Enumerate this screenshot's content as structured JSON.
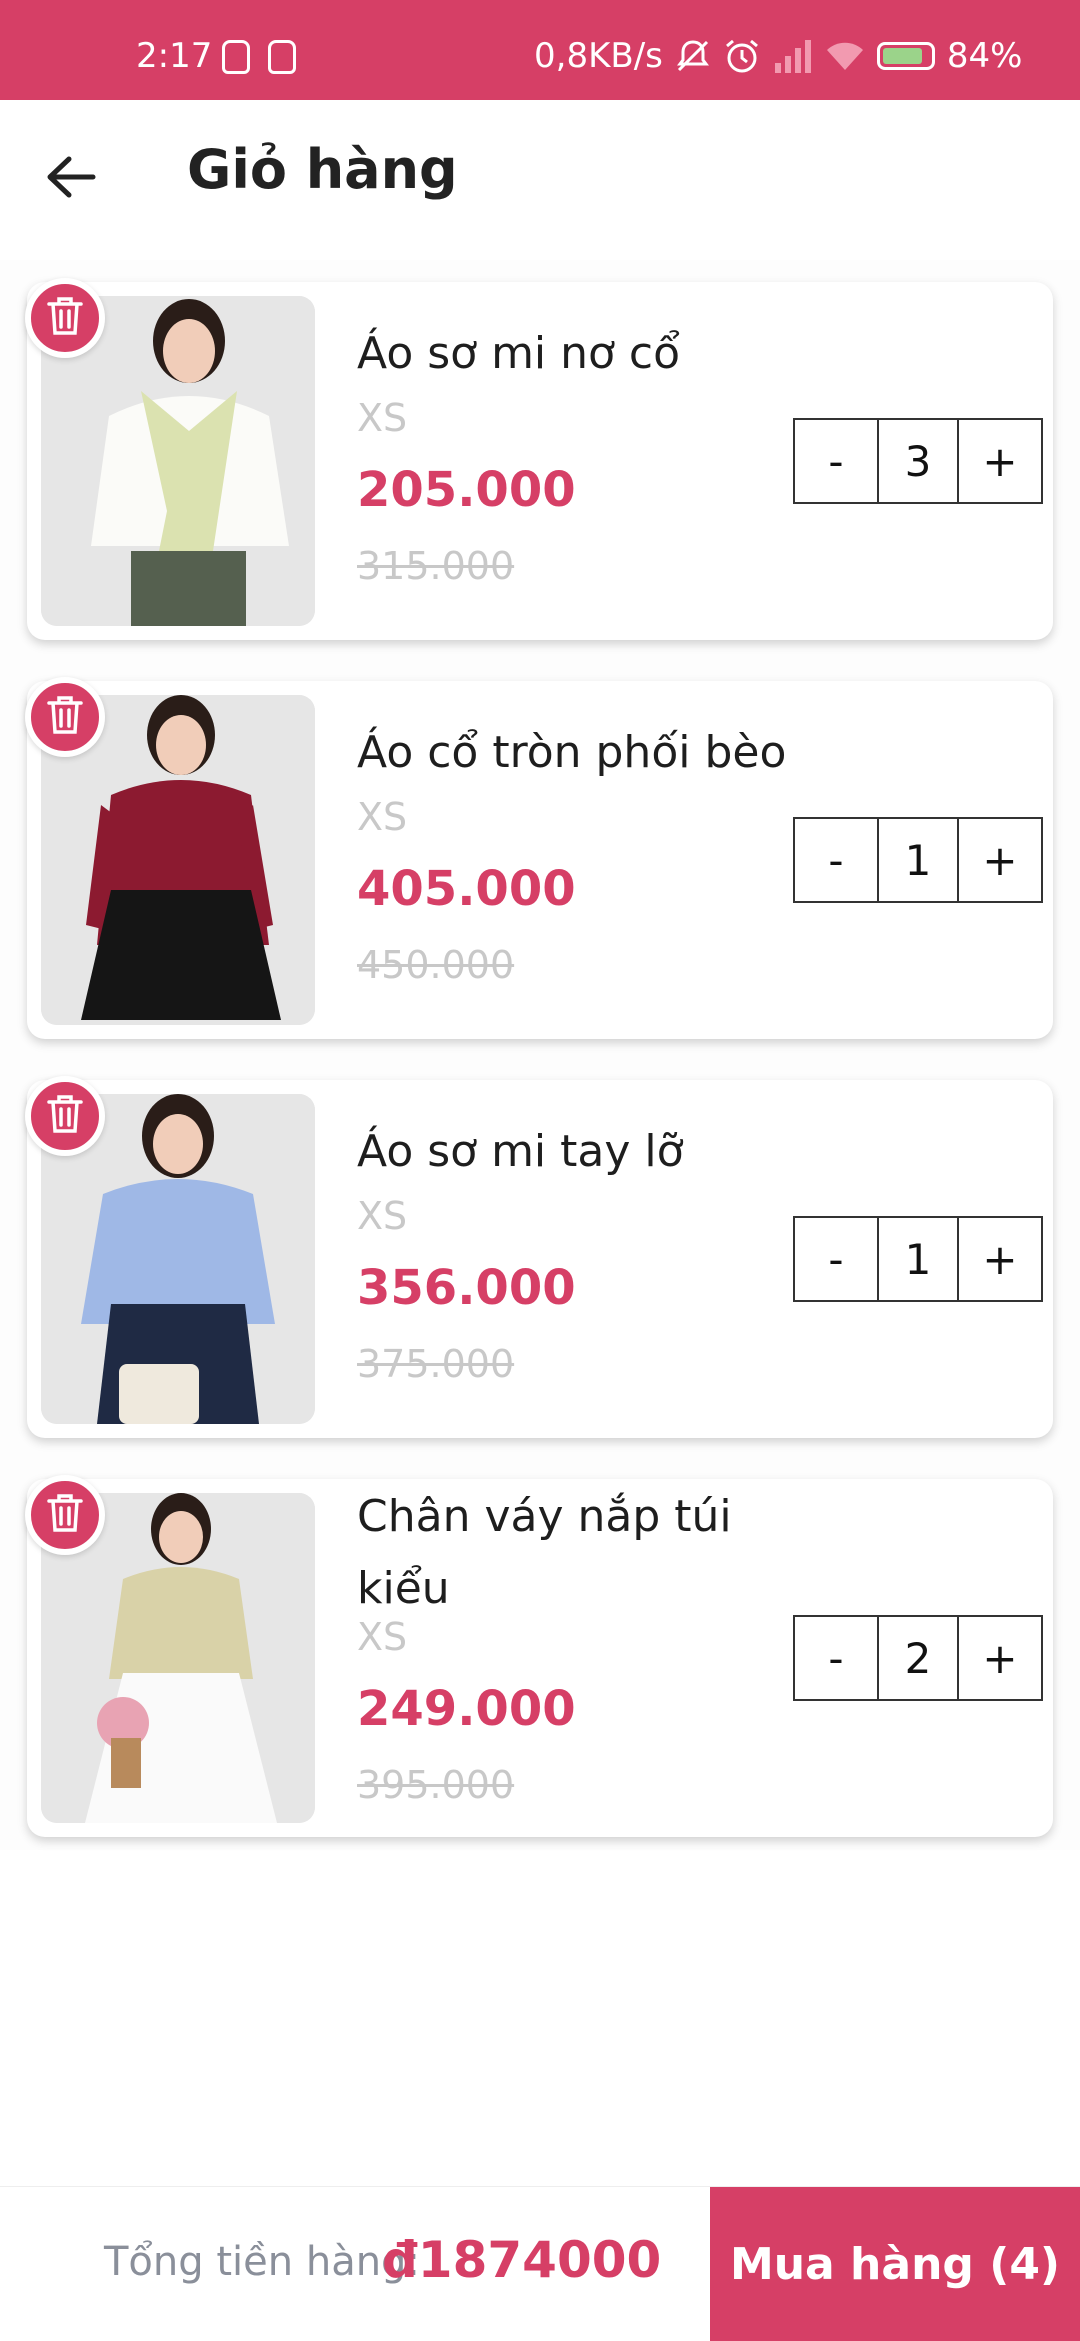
{
  "status_bar": {
    "time": "2:17",
    "network_speed": "0,8KB/s",
    "battery": "84%",
    "battery_level": 0.84,
    "icons": [
      "notification-app-icon",
      "notification-app-icon",
      "bell-off-icon",
      "alarm-icon",
      "signal-icon",
      "wifi-icon",
      "battery-charging-icon"
    ]
  },
  "header": {
    "title": "Giỏ hàng",
    "back_icon": "arrow-left-icon"
  },
  "colors": {
    "accent": "#d63f66",
    "muted": "#c8c8c8",
    "text": "#1e1e1e"
  },
  "items": [
    {
      "name": "Áo sơ mi nơ cổ",
      "size": "XS",
      "price": "205.000",
      "old_price": "315.000",
      "qty": "3",
      "minus": "-",
      "plus": "+"
    },
    {
      "name": "Áo cổ tròn phối bèo",
      "size": "XS",
      "price": "405.000",
      "old_price": "450.000",
      "qty": "1",
      "minus": "-",
      "plus": "+"
    },
    {
      "name": "Áo sơ mi tay lỡ",
      "size": "XS",
      "price": "356.000",
      "old_price": "375.000",
      "qty": "1",
      "minus": "-",
      "plus": "+"
    },
    {
      "name": "Chân váy nắp túi kiểu",
      "size": "XS",
      "price": "249.000",
      "old_price": "395.000",
      "qty": "2",
      "minus": "-",
      "plus": "+"
    }
  ],
  "footer": {
    "total_label": "Tổng tiền hàng:",
    "total_value": "đ1874000",
    "buy_label": "Mua hàng (4)"
  }
}
